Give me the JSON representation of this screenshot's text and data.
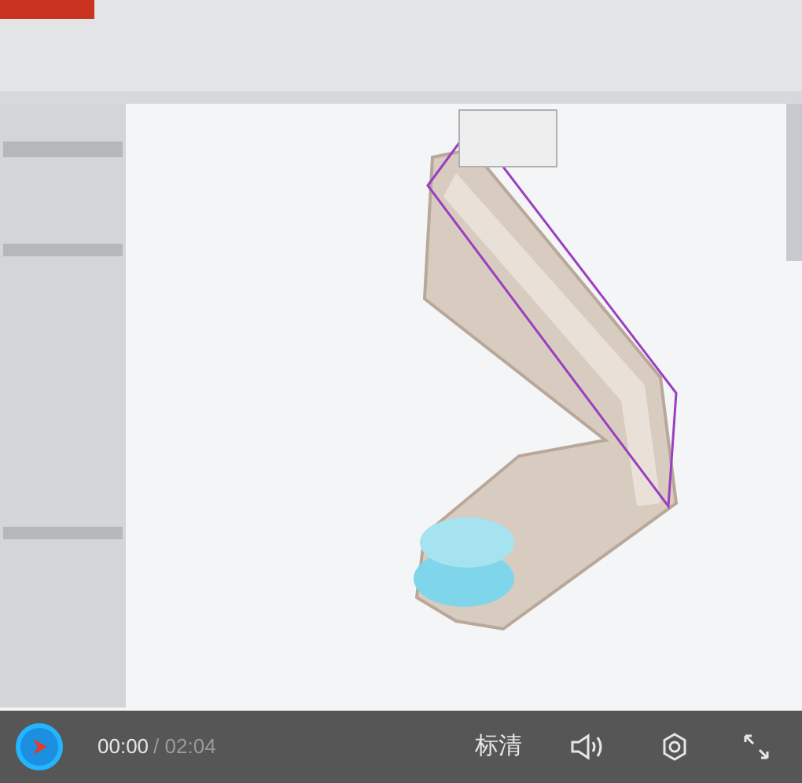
{
  "controls": {
    "current_time": "00:00",
    "duration": "/ 02:04",
    "quality": "标清"
  }
}
